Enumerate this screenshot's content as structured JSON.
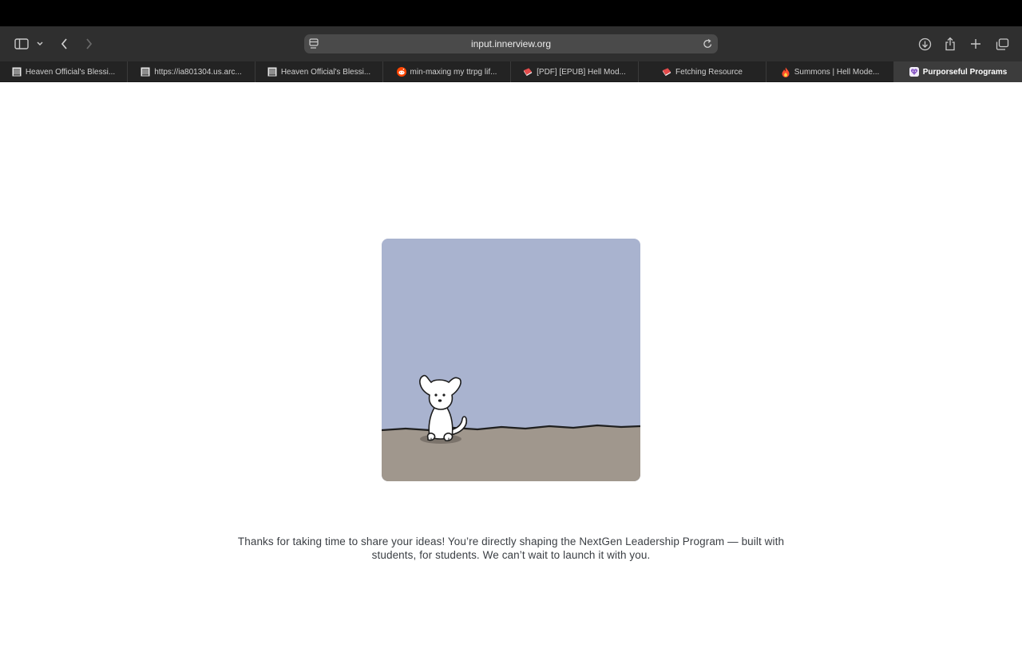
{
  "browser": {
    "url": "input.innerview.org",
    "tabs": [
      {
        "label": "Heaven Official's Blessi...",
        "icon": "archive-icon",
        "active": false
      },
      {
        "label": "https://ia801304.us.arc...",
        "icon": "archive-icon",
        "active": false
      },
      {
        "label": "Heaven Official's Blessi...",
        "icon": "archive-icon",
        "active": false
      },
      {
        "label": "min-maxing my ttrpg lif...",
        "icon": "reddit-icon",
        "active": false
      },
      {
        "label": "[PDF] [EPUB] Hell Mod...",
        "icon": "book-icon",
        "active": false
      },
      {
        "label": "Fetching Resource",
        "icon": "book-icon",
        "active": false
      },
      {
        "label": "Summons | Hell Mode...",
        "icon": "flame-icon",
        "active": false
      },
      {
        "label": "Purporseful Programs",
        "icon": "heart-logo-icon",
        "active": true
      }
    ]
  },
  "colors": {
    "sky": "#a9b3cf",
    "ground": "#a0978d",
    "text": "#3b3f44"
  },
  "main": {
    "illustration": "dog-sitting-illustration",
    "message": "Thanks for taking  time to share your ideas! You’re directly shaping the NextGen Leadership Program — built with students, for students. We can’t wait to launch it with you."
  }
}
